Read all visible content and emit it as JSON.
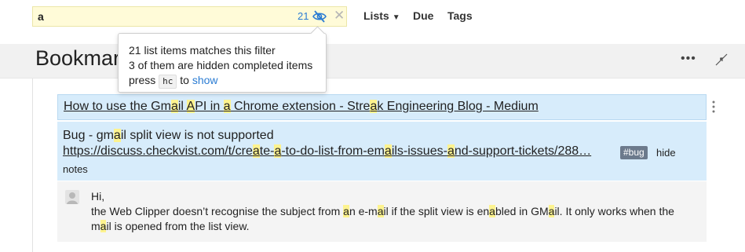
{
  "search": {
    "value": "a",
    "match_count": "21"
  },
  "nav": {
    "lists": "Lists",
    "due": "Due",
    "tags": "Tags"
  },
  "page": {
    "title": "Bookmarks"
  },
  "tooltip": {
    "line1": "21 list items matches this filter",
    "line2": "3 of them are hidden completed items",
    "line3_prefix": "press",
    "shortcut": "hc",
    "line3_mid": "to",
    "show_link": "show"
  },
  "items": [
    {
      "title_segments": [
        "How to use the Gm",
        "a",
        "il ",
        "A",
        "PI in ",
        "a",
        " Chrome extension - Stre",
        "a",
        "k Engineering Blog - Medium"
      ]
    },
    {
      "text_segments": [
        "Bug - gm",
        "a",
        "il split view is not supported"
      ],
      "link_segments": [
        "https://discuss.checkvist.com/t/cre",
        "a",
        "te-",
        "a",
        "-to-do-list-from-em",
        "a",
        "ils-issues-",
        "a",
        "nd-support-tickets/288…"
      ],
      "tag": "#bug",
      "hide_label": "hide",
      "notes_label": "notes",
      "note": {
        "greeting": "Hi,",
        "body_segments": [
          "the Web Clipper doesn’t recognise the subject from ",
          "a",
          "n e-m",
          "a",
          "il if the split view is en",
          "a",
          "bled in GM",
          "a",
          "il. It only works when the m",
          "a",
          "il is opened from the list view."
        ]
      }
    }
  ],
  "colors": {
    "highlight": "#fdf38f",
    "selected_row": "#d7ecfb",
    "link_blue": "#2b7cd3",
    "tag_bg": "#6c7a8c"
  },
  "icons": {
    "hidden": "eye-slash-icon",
    "clear": "close-icon",
    "more": "ellipsis-icon",
    "collapse": "collapse-arrows-icon",
    "row_menu": "vertical-ellipsis-icon",
    "avatar": "user-avatar"
  }
}
